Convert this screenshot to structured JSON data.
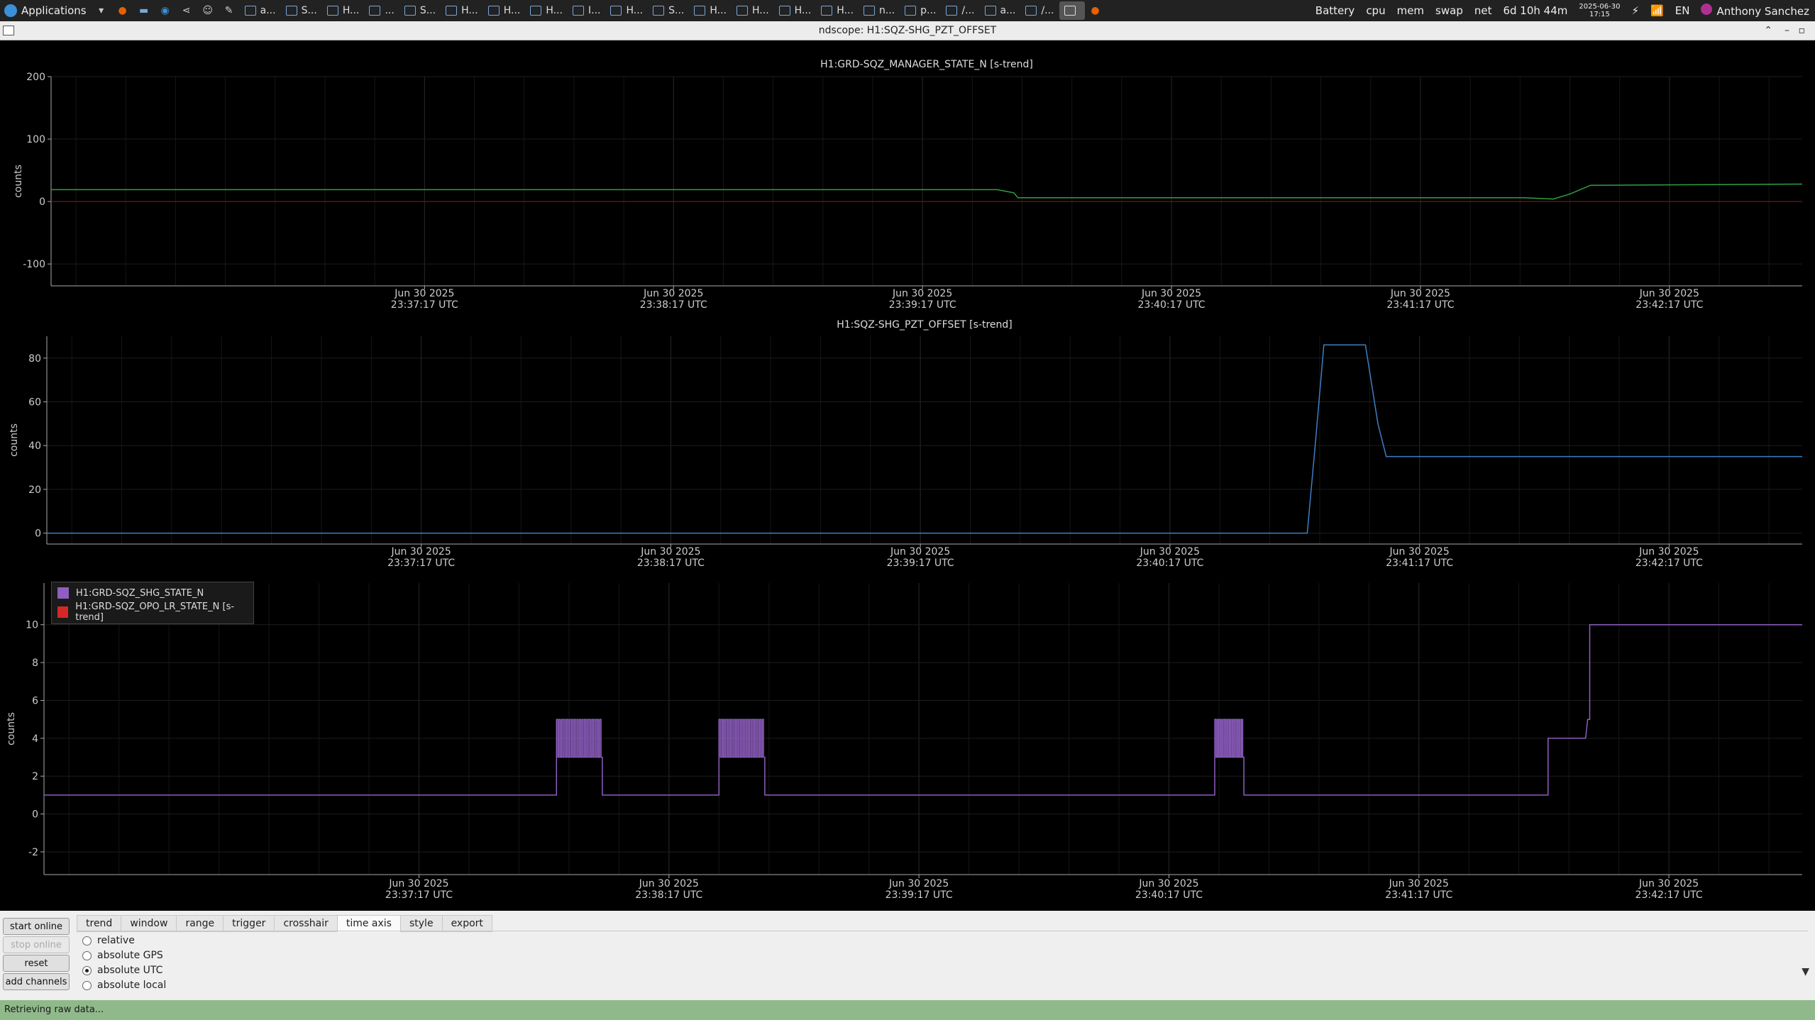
{
  "taskbar": {
    "applications_label": "Applications",
    "windows": [
      "a...",
      "S...",
      "H...",
      "...",
      "S...",
      "H...",
      "H...",
      "H...",
      "I...",
      "H...",
      "S...",
      "H...",
      "H...",
      "H...",
      "H...",
      "n...",
      "p...",
      "/...",
      "a...",
      "/..."
    ],
    "status_items": [
      "Battery",
      "cpu",
      "mem",
      "swap",
      "net"
    ],
    "uptime": "6d 10h 44m",
    "date": "2025-06-30",
    "time": "17:15",
    "language": "EN",
    "user": "Anthony Sanchez"
  },
  "window": {
    "title": "ndscope: H1:SQZ-SHG_PZT_OFFSET"
  },
  "plots": [
    {
      "title": "H1:GRD-SQZ_MANAGER_STATE_N [s-trend]",
      "ylabel": "counts",
      "ylim": [
        -135,
        200
      ],
      "yticks": [
        200,
        100,
        0,
        -100
      ],
      "color": "#2ea043"
    },
    {
      "title": "H1:SQZ-SHG_PZT_OFFSET [s-trend]",
      "ylabel": "counts",
      "ylim": [
        -5,
        90
      ],
      "yticks": [
        80,
        60,
        40,
        20,
        0
      ],
      "color": "#3d7fc4"
    },
    {
      "title": "",
      "ylabel": "counts",
      "ylim": [
        -3.2,
        12.2
      ],
      "yticks": [
        10,
        8,
        6,
        4,
        2,
        0,
        -2
      ],
      "color": "#8e5ec0"
    }
  ],
  "xaxis": {
    "ticks": [
      {
        "date": "Jun 30 2025",
        "time": "23:37:17 UTC"
      },
      {
        "date": "Jun 30 2025",
        "time": "23:38:17 UTC"
      },
      {
        "date": "Jun 30 2025",
        "time": "23:39:17 UTC"
      },
      {
        "date": "Jun 30 2025",
        "time": "23:40:17 UTC"
      },
      {
        "date": "Jun 30 2025",
        "time": "23:41:17 UTC"
      },
      {
        "date": "Jun 30 2025",
        "time": "23:42:17 UTC"
      }
    ]
  },
  "legend": {
    "items": [
      {
        "label": "H1:GRD-SQZ_SHG_STATE_N",
        "color": "#8e5ec0"
      },
      {
        "label": "H1:GRD-SQZ_OPO_LR_STATE_N [s-trend]",
        "color": "#d62728"
      }
    ]
  },
  "controls": {
    "start_online": "start online",
    "stop_online": "stop online",
    "reset": "reset",
    "add_channels": "add channels",
    "tabs": [
      "trend",
      "window",
      "range",
      "trigger",
      "crosshair",
      "time axis",
      "style",
      "export"
    ],
    "active_tab": "time axis",
    "time_axis_options": [
      "relative",
      "absolute GPS",
      "absolute UTC",
      "absolute local"
    ],
    "selected_option": "absolute UTC"
  },
  "status": {
    "text": "Retrieving raw data..."
  },
  "chart_data": [
    {
      "type": "line",
      "title": "H1:GRD-SQZ_MANAGER_STATE_N [s-trend]",
      "ylabel": "counts",
      "ylim": [
        -135,
        200
      ],
      "x_unit": "seconds after 23:37:17 UTC",
      "xlim": [
        -90,
        332
      ],
      "series": [
        {
          "points": [
            [
              -90,
              19
            ],
            [
              138,
              19
            ],
            [
              142,
              14
            ],
            [
              143,
              6
            ],
            [
              265,
              6
            ],
            [
              272,
              4
            ],
            [
              276,
              12
            ],
            [
              281,
              26
            ],
            [
              332,
              28
            ]
          ]
        },
        {
          "points": [
            [
              -90,
              0
            ],
            [
              332,
              0
            ]
          ]
        }
      ]
    },
    {
      "type": "line",
      "title": "H1:SQZ-SHG_PZT_OFFSET [s-trend]",
      "ylabel": "counts",
      "ylim": [
        -5,
        90
      ],
      "x_unit": "seconds after 23:37:17 UTC",
      "xlim": [
        -90,
        332
      ],
      "series": [
        {
          "points": [
            [
              -90,
              0
            ],
            [
              213,
              0
            ],
            [
              215,
              42
            ],
            [
              217,
              86
            ],
            [
              227,
              86
            ],
            [
              230,
              50
            ],
            [
              232,
              35
            ],
            [
              332,
              35
            ]
          ]
        }
      ]
    },
    {
      "type": "line",
      "title": "",
      "ylabel": "counts",
      "ylim": [
        -3.2,
        12.2
      ],
      "x_unit": "seconds after 23:37:17 UTC",
      "xlim": [
        -90,
        332
      ],
      "series": [
        {
          "name": "H1:GRD-SQZ_SHG_STATE_N",
          "segments": [
            {
              "flat": [
                -90,
                1,
                33
              ]
            },
            {
              "osc": [
                33,
                44,
                3,
                5,
                18
              ]
            },
            {
              "flat": [
                44,
                1,
                72
              ]
            },
            {
              "osc": [
                72,
                83,
                3,
                5,
                18
              ]
            },
            {
              "flat": [
                83,
                1,
                191
              ]
            },
            {
              "osc": [
                191,
                198,
                3,
                5,
                12
              ]
            },
            {
              "flat": [
                198,
                1,
                271
              ]
            },
            {
              "flat": [
                271,
                4,
                280
              ]
            },
            {
              "flat": [
                280.5,
                5,
                281
              ]
            },
            {
              "flat": [
                281,
                10,
                332
              ]
            }
          ]
        },
        {
          "name": "H1:GRD-SQZ_OPO_LR_STATE_N [s-trend]",
          "segments": []
        }
      ]
    }
  ]
}
